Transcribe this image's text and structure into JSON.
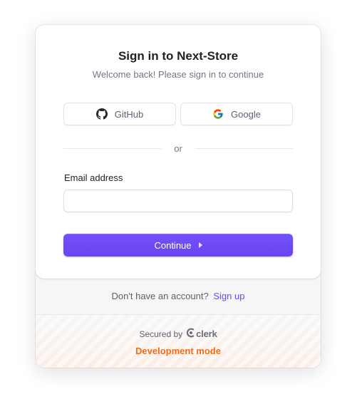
{
  "header": {
    "title": "Sign in to Next-Store",
    "subtitle": "Welcome back! Please sign in to continue"
  },
  "social": {
    "github_label": "GitHub",
    "github_icon": "github-icon",
    "google_label": "Google",
    "google_icon": "google-icon"
  },
  "divider": {
    "text": "or"
  },
  "form": {
    "email_label": "Email address",
    "email_value": "",
    "continue_label": "Continue"
  },
  "footer": {
    "prompt": "Don't have an account?",
    "signup_link": "Sign up",
    "secured_by": "Secured by",
    "brand": "clerk",
    "dev_mode": "Development mode"
  },
  "colors": {
    "primary": "#6c47ff",
    "dev_mode": "#f36b16",
    "title": "#212126",
    "muted": "#747686"
  }
}
